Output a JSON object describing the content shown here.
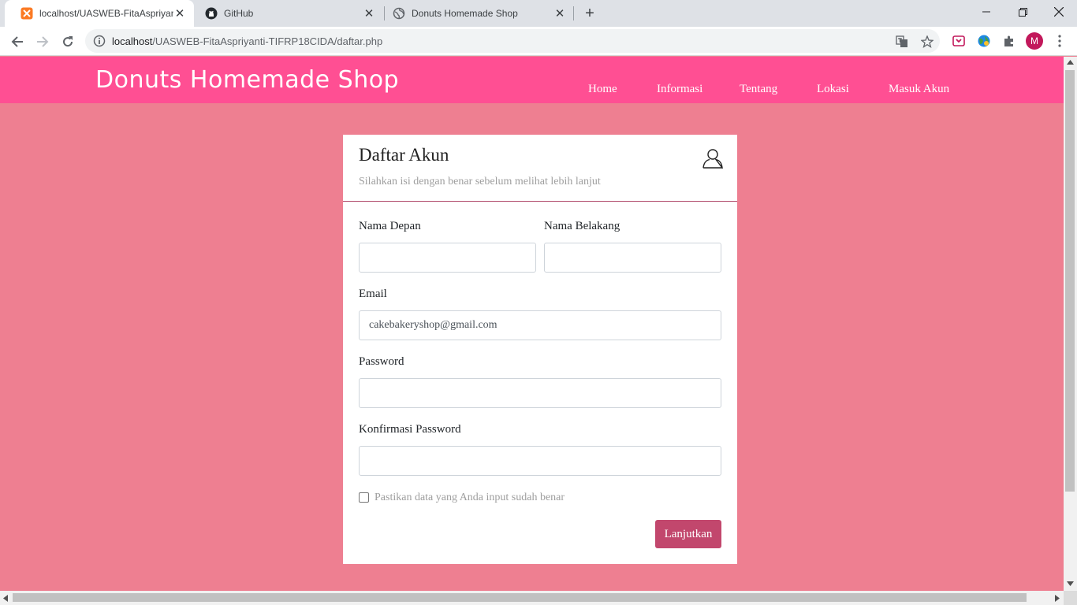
{
  "browser": {
    "tabs": [
      {
        "title": "localhost/UASWEB-FitaAspriyanti-TIFRP18CIDA/daftar.php",
        "favicon": "xampp-icon",
        "active": true
      },
      {
        "title": "GitHub",
        "favicon": "github-icon",
        "active": false
      },
      {
        "title": "Donuts Homemade Shop",
        "favicon": "globe-icon",
        "active": false
      }
    ],
    "url_host": "localhost",
    "url_path": "/UASWEB-FitaAspriyanti-TIFRP18CIDA/daftar.php",
    "profile_initial": "M"
  },
  "site": {
    "brand": "Donuts Homemade Shop",
    "nav": [
      "Home",
      "Informasi",
      "Tentang",
      "Lokasi",
      "Masuk Akun"
    ]
  },
  "form": {
    "title": "Daftar Akun",
    "subtitle": "Silahkan isi dengan benar sebelum melihat lebih lanjut",
    "first_name_label": "Nama Depan",
    "first_name_value": "",
    "last_name_label": "Nama Belakang",
    "last_name_value": "",
    "email_label": "Email",
    "email_value": "cakebakeryshop@gmail.com",
    "password_label": "Password",
    "password_value": "",
    "confirm_label": "Konfirmasi Password",
    "confirm_value": "",
    "checkbox_label": "Pastikan data yang Anda input sudah benar",
    "checkbox_checked": false,
    "submit_label": "Lanjutkan"
  },
  "colors": {
    "header": "#ff4f93",
    "page_background": "#ee7f91",
    "button": "#c2476d"
  }
}
